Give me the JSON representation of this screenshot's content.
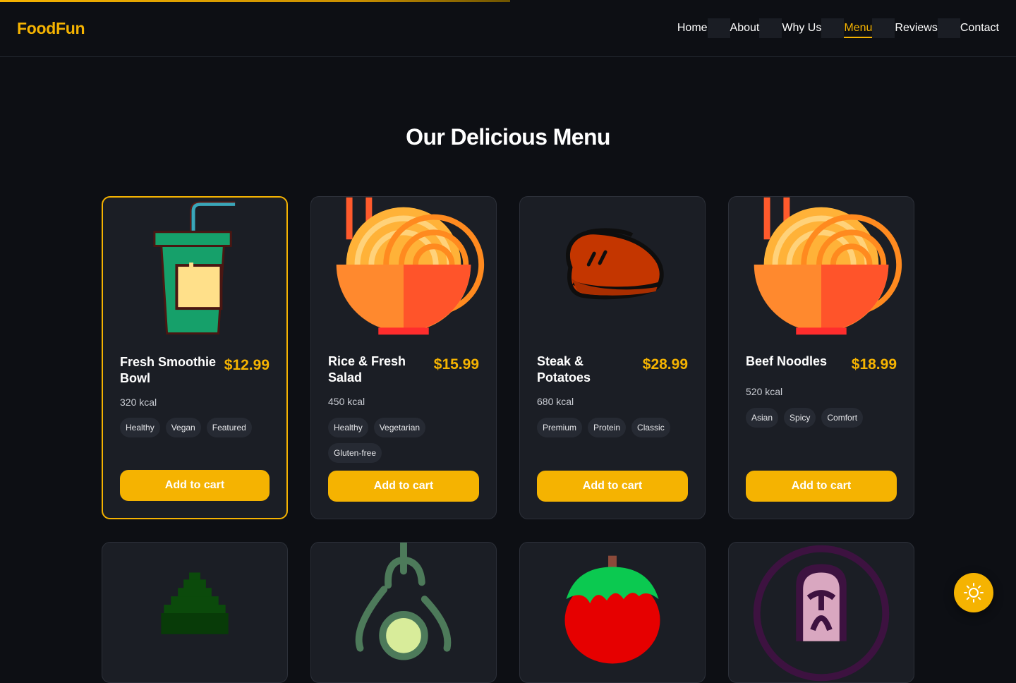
{
  "brand": "FoodFun",
  "nav": {
    "items": [
      "Home",
      "About",
      "Why Us",
      "Menu",
      "Reviews",
      "Contact"
    ],
    "active": "Menu"
  },
  "scroll_progress": 0.5,
  "section_title": "Our Delicious Menu",
  "menu": [
    {
      "name": "Fresh Smoothie Bowl",
      "price": "$12.99",
      "kcal": "320 kcal",
      "tags": [
        "Healthy",
        "Vegan",
        "Featured"
      ],
      "featured": true,
      "illustration": "smoothie-cup-icon"
    },
    {
      "name": "Rice & Fresh Salad",
      "price": "$15.99",
      "kcal": "450 kcal",
      "tags": [
        "Healthy",
        "Vegetarian",
        "Gluten-free"
      ],
      "featured": false,
      "illustration": "noodle-bowl-icon"
    },
    {
      "name": "Steak & Potatoes",
      "price": "$28.99",
      "kcal": "680 kcal",
      "tags": [
        "Premium",
        "Protein",
        "Classic"
      ],
      "featured": false,
      "illustration": "steak-icon"
    },
    {
      "name": "Beef Noodles",
      "price": "$18.99",
      "kcal": "520 kcal",
      "tags": [
        "Asian",
        "Spicy",
        "Comfort"
      ],
      "featured": false,
      "illustration": "noodle-bowl-icon"
    }
  ],
  "menu_row2_illustrations": [
    "broccoli-icon",
    "avocado-icon",
    "tomato-icon",
    "salmon-icon"
  ],
  "add_to_cart_label": "Add to cart",
  "theme_toggle_icon": "sun-icon",
  "colors": {
    "accent": "#f5b301",
    "background": "#0d0f14",
    "card": "#1b1e25",
    "tag": "#262a33"
  }
}
